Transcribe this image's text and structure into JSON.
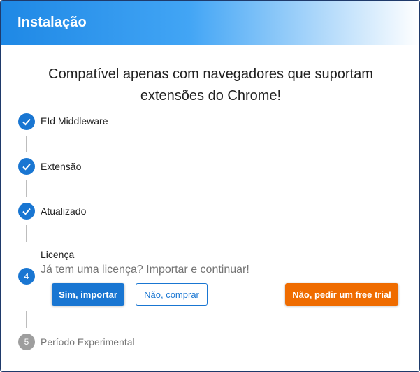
{
  "dialog": {
    "title": "Instalação",
    "headline_line1": "Compatível apenas com navegadores que suportam",
    "headline_line2": "extensões do Chrome!"
  },
  "steps": [
    {
      "label": "EId Middleware",
      "status": "done"
    },
    {
      "label": "Extensão",
      "status": "done"
    },
    {
      "label": "Atualizado",
      "status": "done"
    },
    {
      "label": "Licença",
      "status": "active",
      "number": "4",
      "subtitle": "Já tem uma licença? Importar e continuar!"
    },
    {
      "label": "Período Experimental",
      "status": "pending",
      "number": "5"
    }
  ],
  "actions": {
    "import": "Sim, importar",
    "buy": "Não, comprar",
    "trial": "Não, pedir um free trial"
  },
  "colors": {
    "primary": "#1976d2",
    "accent_orange": "#ef6c00",
    "pending": "#9e9e9e"
  }
}
